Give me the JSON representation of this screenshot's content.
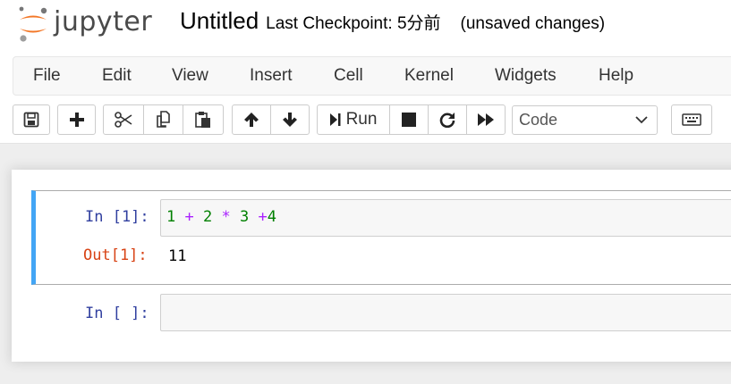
{
  "header": {
    "logo_text": "jupyter",
    "notebook_title": "Untitled",
    "checkpoint": "Last Checkpoint: 5分前",
    "autosave_status": "(unsaved changes)"
  },
  "menubar": {
    "items": [
      "File",
      "Edit",
      "View",
      "Insert",
      "Cell",
      "Kernel",
      "Widgets",
      "Help"
    ]
  },
  "toolbar": {
    "run_label": "Run",
    "cell_type": "Code",
    "buttons": [
      "save-icon",
      "plus-icon",
      "cut-icon",
      "copy-icon",
      "paste-icon",
      "arrow-up-icon",
      "arrow-down-icon",
      "run-icon",
      "stop-icon",
      "restart-icon",
      "fast-forward-icon",
      "keyboard-icon"
    ]
  },
  "cells": [
    {
      "in_prompt": "In [1]:",
      "code_tokens": [
        {
          "t": "1",
          "c": "num"
        },
        {
          "t": " ",
          "c": ""
        },
        {
          "t": "+",
          "c": "op"
        },
        {
          "t": " ",
          "c": ""
        },
        {
          "t": "2",
          "c": "num"
        },
        {
          "t": " ",
          "c": ""
        },
        {
          "t": "*",
          "c": "op"
        },
        {
          "t": " ",
          "c": ""
        },
        {
          "t": "3",
          "c": "num"
        },
        {
          "t": " ",
          "c": ""
        },
        {
          "t": "+",
          "c": "op"
        },
        {
          "t": "4",
          "c": "num"
        }
      ],
      "out_prompt": "Out[1]:",
      "output": "11"
    },
    {
      "in_prompt": "In [ ]:",
      "code_tokens": []
    }
  ],
  "colors": {
    "selected_cell_bar": "#42a5f5",
    "in_prompt": "#303f9f",
    "out_prompt": "#d84315",
    "number": "#008000",
    "operator": "#aa22ff",
    "logo_orange": "#f37726"
  }
}
